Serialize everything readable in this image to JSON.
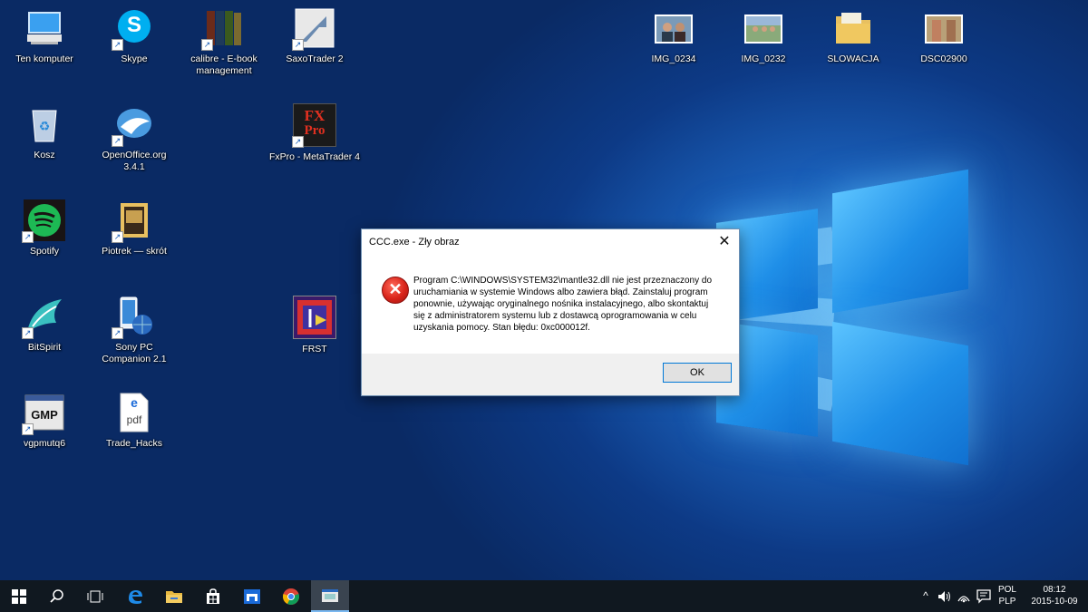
{
  "desktop_icons_left": [
    {
      "label": "Ten komputer",
      "icon": "computer-icon"
    },
    {
      "label": "Skype",
      "icon": "skype-icon"
    },
    {
      "label": "calibre - E-book management",
      "icon": "calibre-icon"
    },
    {
      "label": "SaxoTrader 2",
      "icon": "saxotrader-icon"
    },
    {
      "label": "Kosz",
      "icon": "recycle-bin-icon"
    },
    {
      "label": "OpenOffice.org 3.4.1",
      "icon": "openoffice-icon"
    },
    {
      "label": "FxPro - MetaTrader 4",
      "icon": "fxpro-icon"
    },
    {
      "label": "Spotify",
      "icon": "spotify-icon"
    },
    {
      "label": "Piotrek — skrót",
      "icon": "folder-shortcut-icon"
    },
    {
      "label": "BitSpirit",
      "icon": "bitspirit-icon"
    },
    {
      "label": "Sony PC Companion 2.1",
      "icon": "sony-pc-companion-icon"
    },
    {
      "label": "FRST",
      "icon": "frst-icon"
    },
    {
      "label": "vgpmutq6",
      "icon": "vgpmutq6-icon"
    },
    {
      "label": "Trade_Hacks",
      "icon": "pdf-file-icon"
    }
  ],
  "desktop_icons_right": [
    {
      "label": "IMG_0234",
      "icon": "photo-icon"
    },
    {
      "label": "IMG_0232",
      "icon": "photo-icon"
    },
    {
      "label": "SLOWACJA",
      "icon": "folder-icon"
    },
    {
      "label": "DSC02900",
      "icon": "photo-icon"
    }
  ],
  "icon_text": {
    "skype": "S",
    "fxpro_line1": "FX",
    "fxpro_line2": "Pro",
    "vgp": "GMP",
    "pdf_e": "e",
    "pdf": "pdf"
  },
  "dialog": {
    "title": "CCC.exe - Zły obraz",
    "close": "✕",
    "error_glyph": "✕",
    "message": "Program C:\\WINDOWS\\SYSTEM32\\mantle32.dll nie jest przeznaczony do uruchamiania w systemie Windows albo zawiera błąd. Zainstaluj program ponownie, używając oryginalnego nośnika instalacyjnego, albo skontaktuj się z administratorem systemu lub z dostawcą oprogramowania w celu uzyskania pomocy. Stan błędu: 0xc000012f.",
    "ok_label": "OK"
  },
  "taskbar": {
    "lang_top": "POL",
    "lang_bottom": "PLP",
    "time": "08:12",
    "date": "2015-10-09",
    "tray_chevron": "^"
  },
  "colors": {
    "accent": "#0078d7",
    "taskbar": "#101820",
    "error": "#d9241a"
  }
}
